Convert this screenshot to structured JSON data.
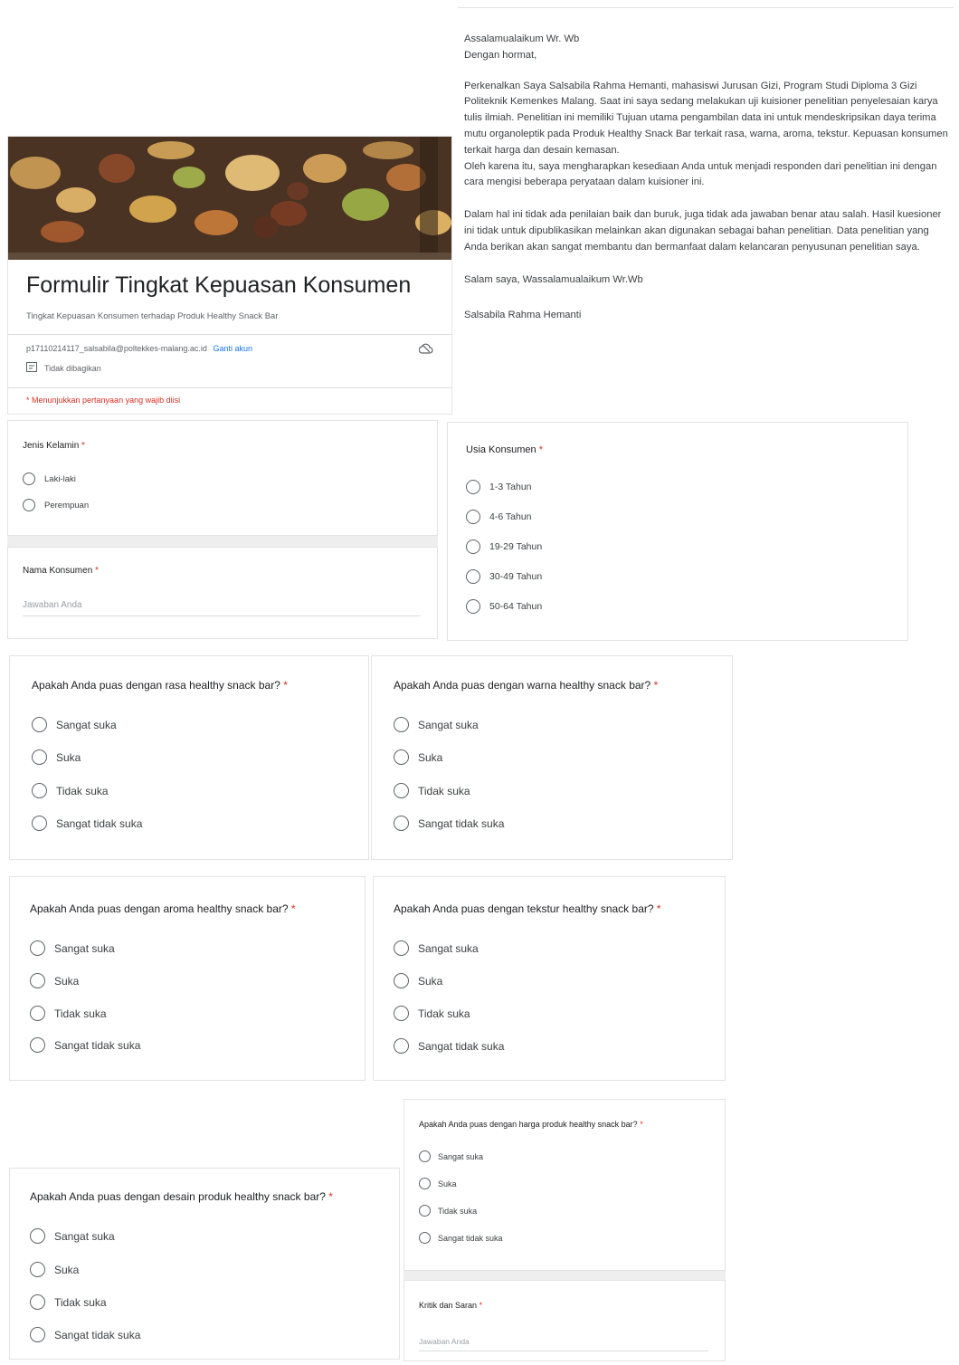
{
  "letter": {
    "greeting": "Assalamualaikum Wr. Wb",
    "salutation": "Dengan hormat,",
    "para1": "Perkenalkan Saya Salsabila Rahma Hemanti, mahasiswi Jurusan Gizi, Program Studi Diploma 3 Gizi Politeknik Kemenkes Malang. Saat ini saya sedang melakukan uji kuisioner penelitian penyelesaian karya tulis ilmiah. Penelitian ini memiliki Tujuan utama pengambilan data ini untuk mendeskripsikan daya terima mutu organoleptik pada Produk Healthy Snack Bar terkait rasa, warna, aroma, tekstur. Kepuasan konsumen terkait harga dan desain kemasan.",
    "para2": "Oleh karena itu, saya mengharapkan kesediaan Anda untuk menjadi responden dari penelitian ini dengan cara mengisi beberapa peryataan dalam kuisioner ini.",
    "para3": "Dalam hal ini tidak ada penilaian baik dan buruk, juga tidak ada jawaban benar atau salah. Hasil kuesioner ini tidak untuk dipublikasikan melainkan akan digunakan sebagai bahan penelitian. Data penelitian yang Anda berikan akan sangat membantu dan bermanfaat dalam kelancaran penyusunan penelitian saya.",
    "closing": "Salam saya, Wassalamualaikum Wr.Wb",
    "signature": "Salsabila Rahma Hemanti"
  },
  "form": {
    "title": "Formulir Tingkat Kepuasan Konsumen",
    "description": "Tingkat Kepuasan Konsumen terhadap Produk Healthy Snack Bar",
    "account": "p17110214117_salsabila@poltekkes-malang.ac.id",
    "switch_account": "Ganti akun",
    "not_shared": "Tidak dibagikan",
    "required_note": "* Menunjukkan pertanyaan yang wajib diisi"
  },
  "questions": {
    "gender": {
      "label": "Jenis Kelamin",
      "options": [
        "Laki-laki",
        "Perempuan"
      ]
    },
    "name": {
      "label": "Nama Konsumen",
      "placeholder": "Jawaban Anda"
    },
    "age": {
      "label": "Usia Konsumen",
      "options": [
        "1-3 Tahun",
        "4-6 Tahun",
        "19-29 Tahun",
        "30-49 Tahun",
        "50-64 Tahun"
      ]
    },
    "taste": {
      "label": "Apakah Anda puas dengan rasa healthy snack bar?",
      "options": [
        "Sangat suka",
        "Suka",
        "Tidak suka",
        "Sangat tidak suka"
      ]
    },
    "color": {
      "label": "Apakah Anda puas dengan warna healthy snack bar?",
      "options": [
        "Sangat suka",
        "Suka",
        "Tidak suka",
        "Sangat tidak suka"
      ]
    },
    "aroma": {
      "label": "Apakah Anda puas dengan aroma healthy snack bar?",
      "options": [
        "Sangat suka",
        "Suka",
        "Tidak suka",
        "Sangat tidak suka"
      ]
    },
    "texture": {
      "label": "Apakah Anda puas dengan tekstur healthy snack bar?",
      "options": [
        "Sangat suka",
        "Suka",
        "Tidak suka",
        "Sangat tidak suka"
      ]
    },
    "price": {
      "label": "Apakah Anda puas dengan harga produk healthy snack bar?",
      "options": [
        "Sangat suka",
        "Suka",
        "Tidak suka",
        "Sangat tidak suka"
      ]
    },
    "design": {
      "label": "Apakah Anda puas dengan desain produk healthy snack bar?",
      "options": [
        "Sangat suka",
        "Suka",
        "Tidak suka",
        "Sangat tidak suka"
      ]
    },
    "feedback": {
      "label": "Kritik dan Saran",
      "placeholder": "Jawaban Anda"
    }
  },
  "required_mark": "*",
  "colors": {
    "required": "#d93025",
    "link": "#1a73e8",
    "banner_accent": "#5f4b3a"
  }
}
